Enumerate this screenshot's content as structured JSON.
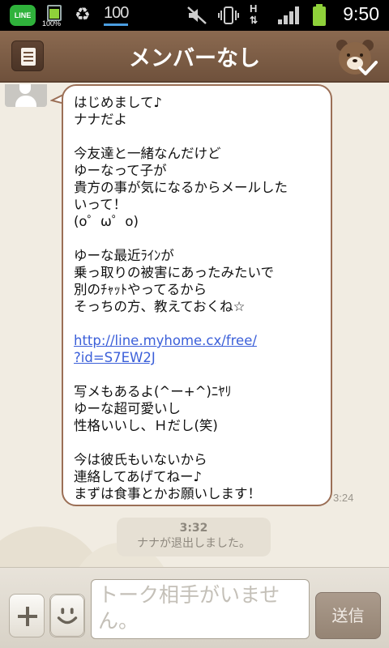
{
  "status_bar": {
    "line_icon_label": "LINE",
    "battery_percent": "100%",
    "sd_label": "100",
    "network_type": "H",
    "time": "9:50"
  },
  "header": {
    "title": "メンバーなし"
  },
  "chat": {
    "message": {
      "lines": [
        "はじめまして♪",
        "ナナだよ",
        "",
        "今友達と一緒なんだけど",
        "ゆーなって子が",
        "貴方の事が気になるからメールした",
        "いって！",
        "(o゜ω゜o)",
        "",
        "ゆーな最近ﾗｲﾝが",
        "乗っ取りの被害にあったみたいで",
        "別のﾁｬｯﾄやってるから",
        "そっちの方、教えておくね☆",
        "",
        "http://line.myhome.cx/free/",
        "?id=S7EW2J",
        "",
        "写メもあるよ(^ー+^)ﾆﾔﾘ",
        "ゆーな超可愛いし",
        "性格いいし、Ｈだし(笑)",
        "",
        "今は彼氏もいないから",
        "連絡してあげてねー♪",
        "まずは食事とかお願いします！"
      ],
      "link_part1": "http://line.myhome.cx/free/",
      "link_part2": "?id=S7EW2J",
      "time": "3:24"
    },
    "system_notice": {
      "time": "3:32",
      "text": "ナナが退出しました。"
    }
  },
  "input_bar": {
    "placeholder": "トーク相手がいません。",
    "send_label": "送信"
  },
  "colors": {
    "header": "#7d5e47",
    "bubble_border": "#9b6f56",
    "background": "#f1ece2",
    "link": "#3b5fd9"
  }
}
